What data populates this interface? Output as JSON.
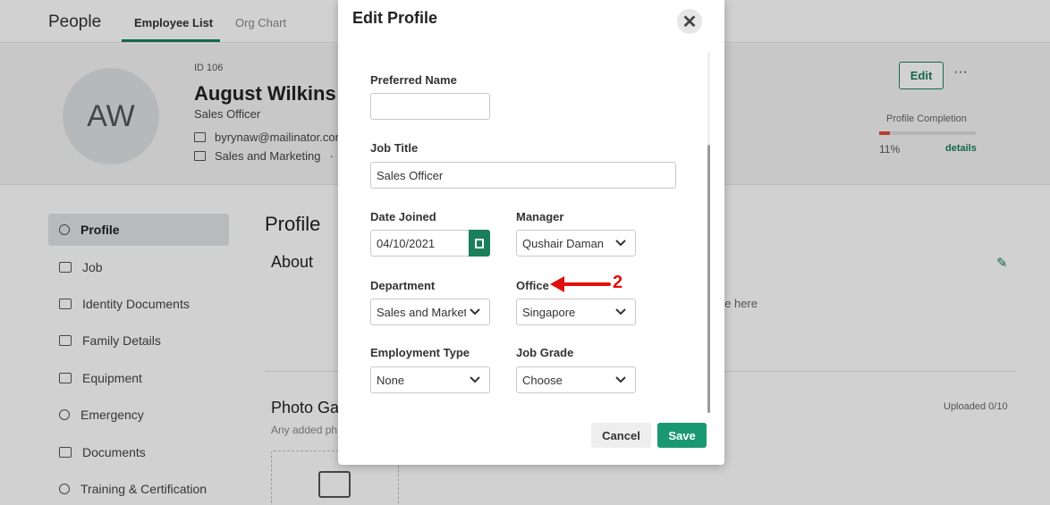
{
  "app": {
    "title": "People",
    "tabs": [
      "Employee List",
      "Org Chart"
    ]
  },
  "employee": {
    "initials": "AW",
    "id_label": "ID 106",
    "name": "August Wilkins",
    "role": "Sales Officer",
    "email": "byrynaw@mailinator.com",
    "department": "Sales and Marketing",
    "dept_separator": "·"
  },
  "actions": {
    "edit_label": "Edit",
    "more_label": "···"
  },
  "completion": {
    "label": "Profile Completion",
    "percent_text": "11%",
    "fraction": 0.11,
    "details_label": "details",
    "bar_color": "#e34a3a"
  },
  "sidebar": {
    "items": [
      {
        "label": "Profile",
        "icon": "person-icon"
      },
      {
        "label": "Job",
        "icon": "briefcase-icon"
      },
      {
        "label": "Identity Documents",
        "icon": "id-card-icon"
      },
      {
        "label": "Family Details",
        "icon": "family-icon"
      },
      {
        "label": "Equipment",
        "icon": "laptop-icon"
      },
      {
        "label": "Emergency",
        "icon": "phone-icon"
      },
      {
        "label": "Documents",
        "icon": "document-icon"
      },
      {
        "label": "Training & Certification",
        "icon": "medal-icon"
      }
    ]
  },
  "main": {
    "heading": "Profile",
    "about_heading": "About",
    "about_empty_text": "ble here",
    "gallery_heading": "Photo Ga",
    "gallery_sub": "Any added ph",
    "gallery_count": "Uploaded 0/10"
  },
  "modal": {
    "title": "Edit Profile",
    "close_label": "✕",
    "fields": {
      "preferred_name": {
        "label": "Preferred Name",
        "value": ""
      },
      "job_title": {
        "label": "Job Title",
        "value": "Sales Officer"
      },
      "date_joined": {
        "label": "Date Joined",
        "value": "04/10/2021"
      },
      "manager": {
        "label": "Manager",
        "value": "Qushair Daman"
      },
      "department": {
        "label": "Department",
        "value": "Sales and Marketing"
      },
      "office": {
        "label": "Office",
        "value": "Singapore"
      },
      "employment_type": {
        "label": "Employment Type",
        "value": "None"
      },
      "job_grade": {
        "label": "Job Grade",
        "value": "Choose"
      }
    },
    "cancel_label": "Cancel",
    "save_label": "Save"
  },
  "annotation": {
    "step_number": "2",
    "color": "#e01010"
  },
  "colors": {
    "accent": "#1a7f5a",
    "save_button": "#1a9970"
  }
}
